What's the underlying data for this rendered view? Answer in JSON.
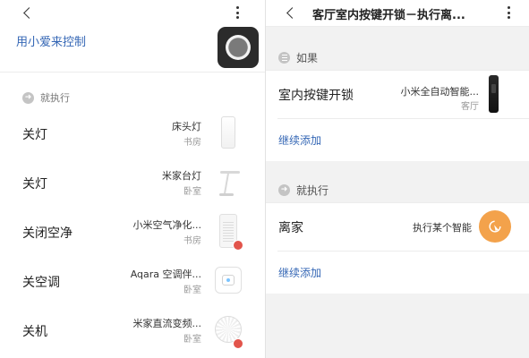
{
  "left": {
    "xiaoai_label": "用小爱来控制",
    "section_label": "就执行",
    "actions": [
      {
        "title": "关灯",
        "device": "床头灯",
        "room": "书房",
        "thumb": "bedside-lamp-icon",
        "badge": false
      },
      {
        "title": "关灯",
        "device": "米家台灯",
        "room": "卧室",
        "thumb": "desk-lamp-icon",
        "badge": false
      },
      {
        "title": "关闭空净",
        "device": "小米空气净化...",
        "room": "书房",
        "thumb": "air-purifier-icon",
        "badge": true
      },
      {
        "title": "关空调",
        "device": "Aqara 空调伴...",
        "room": "卧室",
        "thumb": "ac-companion-icon",
        "badge": false
      },
      {
        "title": "关机",
        "device": "米家直流变频...",
        "room": "卧室",
        "thumb": "fan-icon",
        "badge": true
      }
    ]
  },
  "right": {
    "title": "客厅室内按键开锁－执行离...",
    "if_section": {
      "label": "如果",
      "condition": {
        "title": "室内按键开锁",
        "device": "小米全自动智能...",
        "room": "客厅",
        "thumb": "smart-lock-icon"
      },
      "add_label": "继续添加"
    },
    "then_section": {
      "label": "就执行",
      "action": {
        "title": "离家",
        "device": "执行某个智能",
        "icon": "smart-scene-icon"
      },
      "add_label": "继续添加"
    }
  },
  "colors": {
    "link": "#3567b5",
    "accent_orange": "#f3a24b",
    "badge_red": "#e2544b"
  }
}
